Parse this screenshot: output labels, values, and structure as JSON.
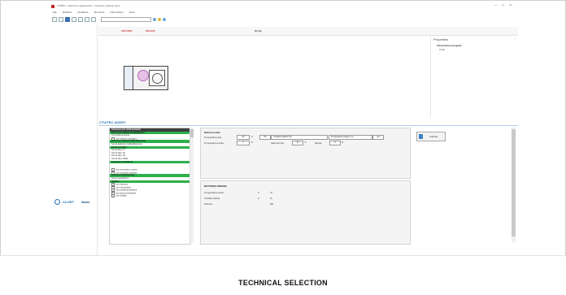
{
  "window": {
    "title": "CYPRO - Selezione apparecchio - Gestione progetti.cypro"
  },
  "menu": [
    "File",
    "Modifica",
    "Visualizza",
    "Strumenti",
    "Informazioni",
    "Aiuto"
  ],
  "tabs": {
    "tab1": "CRV13D3",
    "tab2": "500mc/h",
    "tab3": "8.0 kg"
  },
  "properties": {
    "title": "Properties",
    "item1": "Informazioni progetto",
    "item2": "Unità"
  },
  "section": {
    "title": "CTU/TEC 3220HT"
  },
  "accessories": [
    {
      "type": "selhdr",
      "label": "Accessori per unità terminali"
    },
    {
      "type": "hdr",
      "label": "Accessori batteria riscaldamento"
    },
    {
      "type": "item",
      "label": "Con batteria acqua"
    },
    {
      "type": "chk",
      "label": "Con valvola modulante"
    },
    {
      "type": "hdr",
      "label": "Accessori batteria raffreddamento"
    },
    {
      "type": "item",
      "label": "Senza batteria di raffreddamento"
    },
    {
      "type": "hdr",
      "label": "Accessori filtro"
    },
    {
      "type": "item",
      "label": "Senza filtro F7"
    },
    {
      "type": "item",
      "label": "Senza filtro F9"
    },
    {
      "type": "item",
      "label": "Senza filtro G4"
    },
    {
      "type": "item",
      "label": "Senza filtro ePM1"
    },
    {
      "type": "hdr",
      "label": "Accessori ventilatore"
    },
    {
      "type": "gap",
      "label": ""
    },
    {
      "type": "chk",
      "label": "Con serranda a motore"
    },
    {
      "type": "chk",
      "label": "Con serranda manuale"
    },
    {
      "type": "hdr",
      "label": "Accessori Regolazione"
    },
    {
      "type": "item",
      "label": "Senza regolazione"
    },
    {
      "type": "hdr",
      "label": "Opzioni"
    },
    {
      "type": "chk",
      "label": "Con tettuccio"
    },
    {
      "type": "chk",
      "label": "Con verniciatura"
    },
    {
      "type": "chk",
      "label": "Con piedini antivibranti"
    },
    {
      "type": "chk",
      "label": "Con giunti antivibranti"
    },
    {
      "type": "chk",
      "label": "Con imballo"
    }
  ],
  "inputs": {
    "heading": "Batteria fredda",
    "air_in_label": "Temperatura aria",
    "air_in_value": "26",
    "air_in_unit": "°C",
    "rh_value": "50",
    "rh_label": "Umidità relativa (%)",
    "water_label": "Temperatura acqua (°C)",
    "water_value": "20",
    "water_out_label": "Temperatura uscita",
    "water_out_value": "7",
    "water_out_unit": "°C",
    "glycol_label": "Salto termico",
    "glycol_value": "12",
    "glycol_unit": "°C",
    "fouling_label": "Glicole",
    "fouling_value": "0",
    "fouling_unit": "%"
  },
  "coil": {
    "title": "BATTERIA FREDDA",
    "row1_label": "Temperatura uscita",
    "row1_value": "0",
    "row1_unit": "°C",
    "row2_label": "Umidità relativa",
    "row2_value": "0",
    "row2_unit": "%",
    "row3_label": "Potenza",
    "row3_value": "",
    "row3_unit": "kW"
  },
  "calc": {
    "label": "Calcola"
  },
  "logo": {
    "brand": "CLIVET",
    "sub": "Model"
  },
  "caption": "TECHNICAL SELECTION",
  "colors": {
    "accent": "#1e6fb8",
    "green": "#2db04b",
    "red": "#d32f2f"
  }
}
